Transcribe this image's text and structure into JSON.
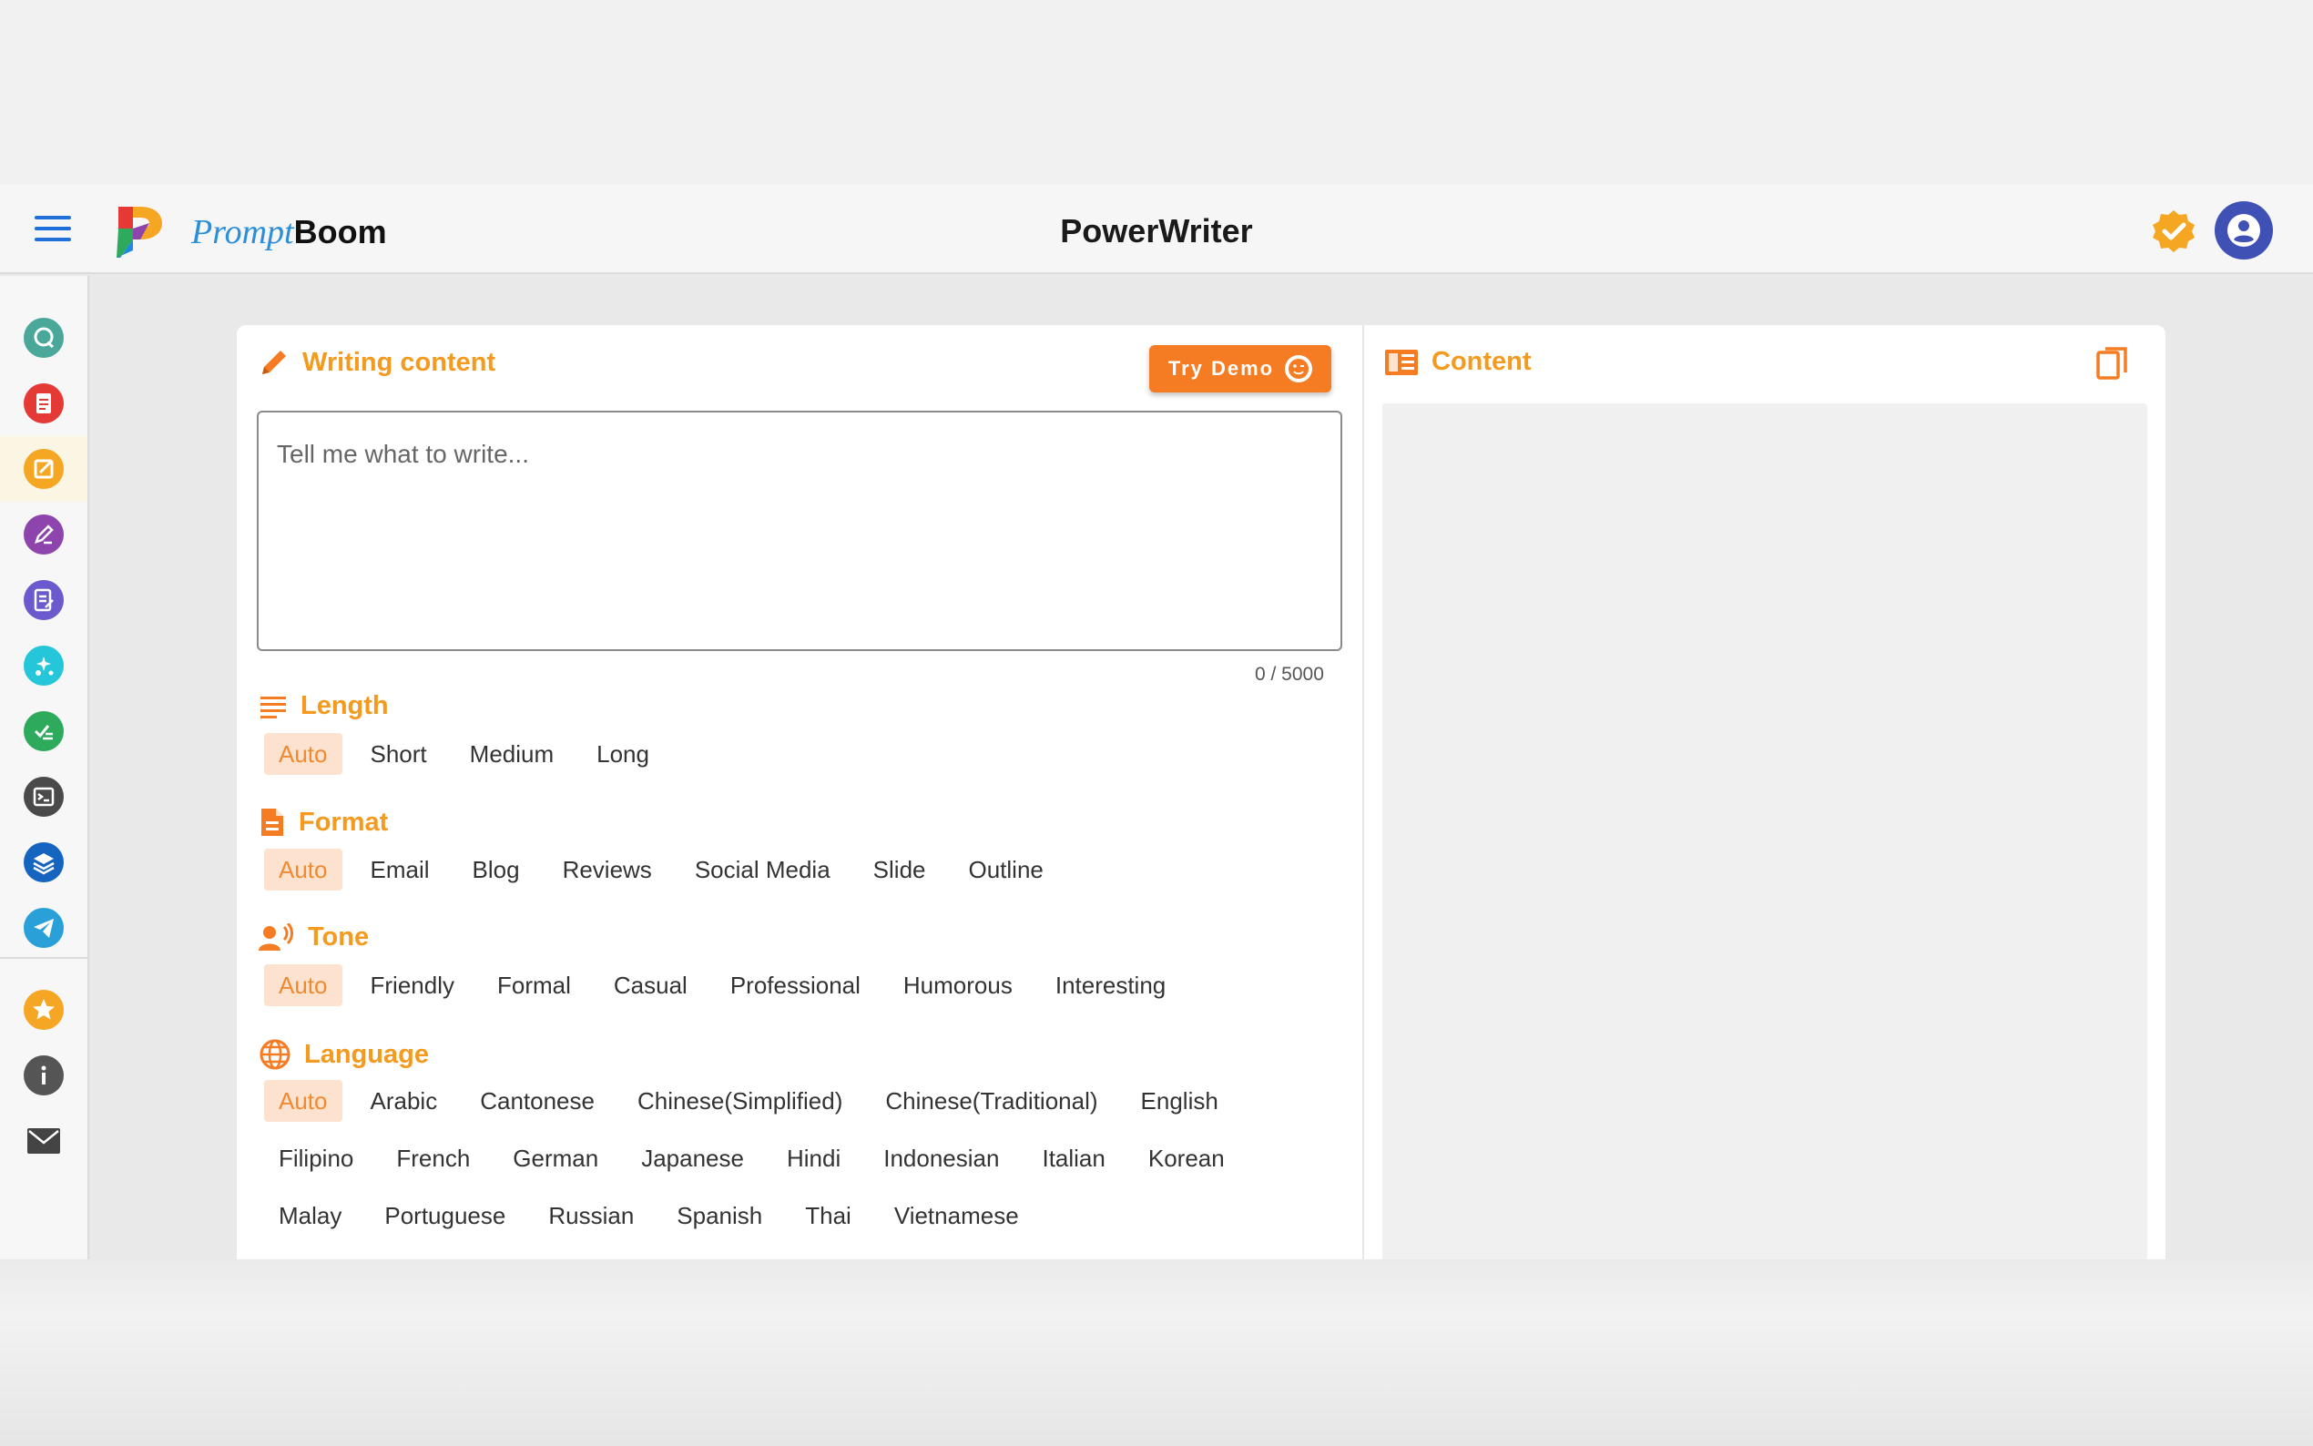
{
  "header": {
    "brand_prompt": "Prompt",
    "brand_boom": "Boom",
    "title": "PowerWriter"
  },
  "sidebar": {
    "items": [
      {
        "icon": "chat-icon",
        "color": "#4aa89a"
      },
      {
        "icon": "document-icon",
        "color": "#e53935"
      },
      {
        "icon": "edit-note-icon",
        "color": "#f5a623",
        "active": true
      },
      {
        "icon": "pencil-icon",
        "color": "#8e44ad"
      },
      {
        "icon": "checklist-doc-icon",
        "color": "#6a5acd"
      },
      {
        "icon": "magic-icon",
        "color": "#26c6da"
      },
      {
        "icon": "grammar-check-icon",
        "color": "#2eaa5c"
      },
      {
        "icon": "terminal-icon",
        "color": "#4a4a4a"
      },
      {
        "icon": "layers-icon",
        "color": "#1565c0"
      },
      {
        "icon": "telegram-icon",
        "color": "#29a0d8"
      }
    ],
    "bottom_items": [
      {
        "icon": "star-icon",
        "color": "#f5a623"
      },
      {
        "icon": "info-icon",
        "color": "#555555"
      },
      {
        "icon": "mail-icon",
        "color": "#444444"
      }
    ]
  },
  "writer": {
    "heading": "Writing content",
    "try_demo": "Try Demo",
    "placeholder": "Tell me what to write...",
    "counter": "0 / 5000",
    "sections": [
      {
        "key": "length",
        "label": "Length",
        "options": [
          "Auto",
          "Short",
          "Medium",
          "Long"
        ],
        "selected": 0
      },
      {
        "key": "format",
        "label": "Format",
        "options": [
          "Auto",
          "Email",
          "Blog",
          "Reviews",
          "Social Media",
          "Slide",
          "Outline"
        ],
        "selected": 0
      },
      {
        "key": "tone",
        "label": "Tone",
        "options": [
          "Auto",
          "Friendly",
          "Formal",
          "Casual",
          "Professional",
          "Humorous",
          "Interesting"
        ],
        "selected": 0
      },
      {
        "key": "language",
        "label": "Language",
        "options": [
          "Auto",
          "Arabic",
          "Cantonese",
          "Chinese(Simplified)",
          "Chinese(Traditional)",
          "English",
          "Filipino",
          "French",
          "German",
          "Japanese",
          "Hindi",
          "Indonesian",
          "Italian",
          "Korean",
          "Malay",
          "Portuguese",
          "Russian",
          "Spanish",
          "Thai",
          "Vietnamese"
        ],
        "selected": 0
      }
    ]
  },
  "output": {
    "heading": "Content"
  },
  "colors": {
    "accent": "#f39a1f",
    "button": "#f57c22",
    "chip_selected_bg": "#fde3cf"
  }
}
